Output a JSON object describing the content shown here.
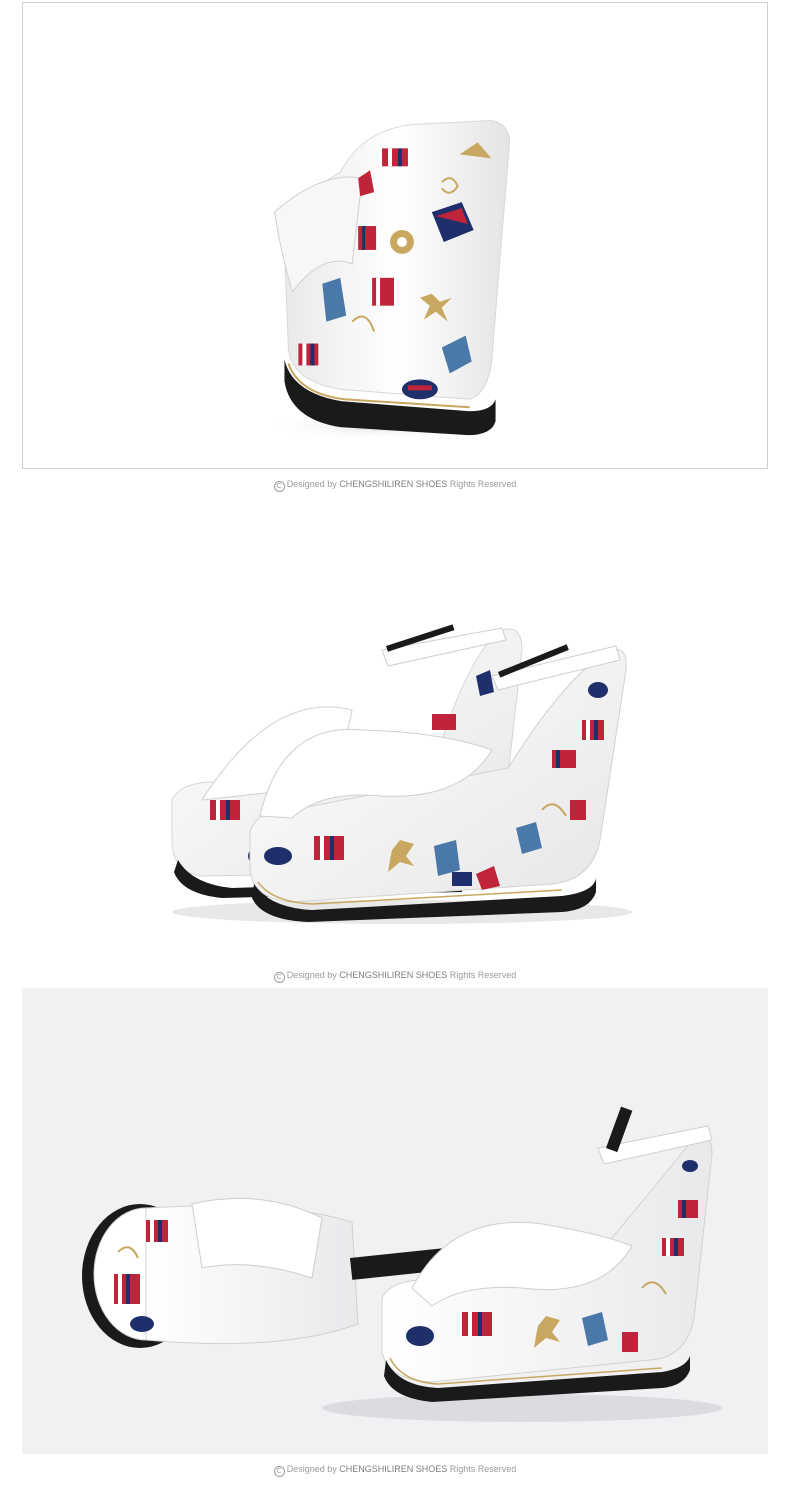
{
  "captions": [
    {
      "symbol": "C",
      "prefix": "Designed by ",
      "brand": "CHENGSHILIREN SHOES",
      "suffix": " Rights Reserved"
    },
    {
      "symbol": "C",
      "prefix": "Designed by ",
      "brand": "CHENGSHILIREN SHOES",
      "suffix": " Rights Reserved"
    },
    {
      "symbol": "C",
      "prefix": "Designed by ",
      "brand": "CHENGSHILIREN SHOES",
      "suffix": " Rights Reserved"
    }
  ],
  "colors": {
    "panel_border": "#cfcfcf",
    "panel_3_background": "#f1f1f3",
    "caption_text": "#9a9a9a",
    "shoe_white": "#ffffff",
    "sole_black": "#1a1a1a",
    "print_red": "#c0243a",
    "print_navy": "#1f2f6b",
    "print_blue": "#4a78a8",
    "print_gold": "#c8a860"
  }
}
